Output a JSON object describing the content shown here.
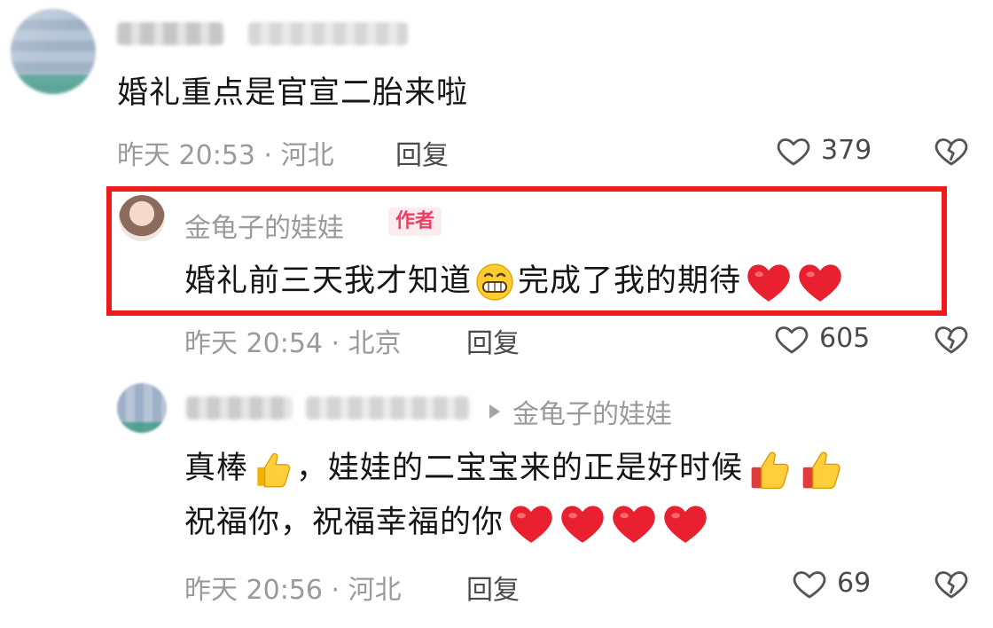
{
  "comments": [
    {
      "text": "婚礼重点是官宣二胎来啦",
      "meta": "昨天 20:53 · 河北",
      "reply_label": "回复",
      "likes": "379"
    },
    {
      "author": "金龟子的娃娃",
      "badge": "作者",
      "text_part1": "婚礼前三天我才知道",
      "text_part2": "完成了我的期待",
      "meta": "昨天 20:54 · 北京",
      "reply_label": "回复",
      "likes": "605"
    },
    {
      "reply_to": "金龟子的娃娃",
      "line1_part1": "真棒",
      "line1_part2": "，娃娃的二宝宝来的正是好时候",
      "line2": "祝福你，祝福幸福的你",
      "meta": "昨天 20:56 · 河北",
      "reply_label": "回复",
      "likes": "69"
    }
  ],
  "icons": {
    "like": "heart-outline-icon",
    "dislike": "broken-heart-outline-icon",
    "emoji_grin": "grinning-face-icon",
    "emoji_heart": "red-heart-icon",
    "emoji_thumbs": "thumbs-up-icon"
  },
  "colors": {
    "highlight_border": "#ef1a1a",
    "badge_text": "#ee3d63",
    "badge_bg": "#fdecef",
    "meta_text": "#9a9a9a",
    "body_text": "#161616"
  }
}
